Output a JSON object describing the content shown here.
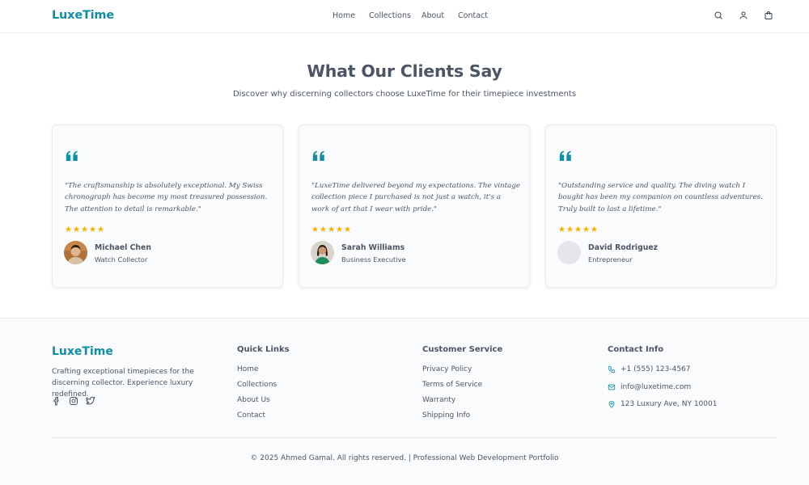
{
  "header": {
    "logo": "LuxeTime",
    "nav": [
      "Home",
      "Collections",
      "About",
      "Contact"
    ],
    "icons": [
      "search-icon",
      "user-icon",
      "shopping-bag-icon"
    ]
  },
  "testimonials": {
    "title": "What Our Clients Say",
    "subtitle": "Discover why discerning collectors choose LuxeTime for their timepiece investments",
    "items": [
      {
        "quote": "\"The craftsmanship is absolutely exceptional. My Swiss chronograph has become my most treasured possession. The attention to detail is remarkable.\"",
        "rating": 5,
        "name": "Michael Chen",
        "role": "Watch Collector"
      },
      {
        "quote": "\"LuxeTime delivered beyond my expectations. The vintage collection piece I purchased is not just a watch, it's a work of art that I wear with pride.\"",
        "rating": 5,
        "name": "Sarah Williams",
        "role": "Business Executive"
      },
      {
        "quote": "\"Outstanding service and quality. The diving watch I bought has been my companion on countless adventures. Truly built to last a lifetime.\"",
        "rating": 5,
        "name": "David Rodriguez",
        "role": "Entrepreneur"
      }
    ]
  },
  "footer": {
    "logo": "LuxeTime",
    "description": "Crafting exceptional timepieces for the discerning collector. Experience luxury redefined.",
    "social_icons": [
      "facebook-icon",
      "instagram-icon",
      "twitter-icon"
    ],
    "quick_links": {
      "heading": "Quick Links",
      "links": [
        "Home",
        "Collections",
        "About Us",
        "Contact"
      ]
    },
    "customer_service": {
      "heading": "Customer Service",
      "links": [
        "Privacy Policy",
        "Terms of Service",
        "Warranty",
        "Shipping Info"
      ]
    },
    "contact": {
      "heading": "Contact Info",
      "phone": "+1 (555) 123-4567",
      "email": "info@luxetime.com",
      "address": "123 Luxury Ave, NY 10001"
    },
    "copyright": "© 2025 Ahmed Gamal. All rights reserved. | Professional Web Development Portfolio"
  },
  "colors": {
    "brand": "#0f8ea4",
    "star": "#f5b400",
    "text": "#4b5563"
  }
}
